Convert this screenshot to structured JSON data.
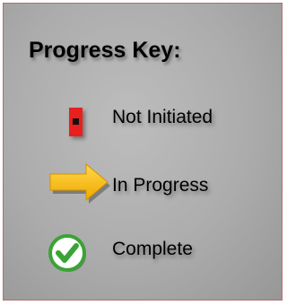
{
  "legend": {
    "title": "Progress Key:",
    "items": [
      {
        "label": "Not Initiated",
        "icon": "red-marker-icon",
        "color": "#e8201e"
      },
      {
        "label": "In Progress",
        "icon": "right-arrow-icon",
        "color": "#f5b80f"
      },
      {
        "label": "Complete",
        "icon": "check-circle-icon",
        "color": "#3aa335"
      }
    ]
  }
}
